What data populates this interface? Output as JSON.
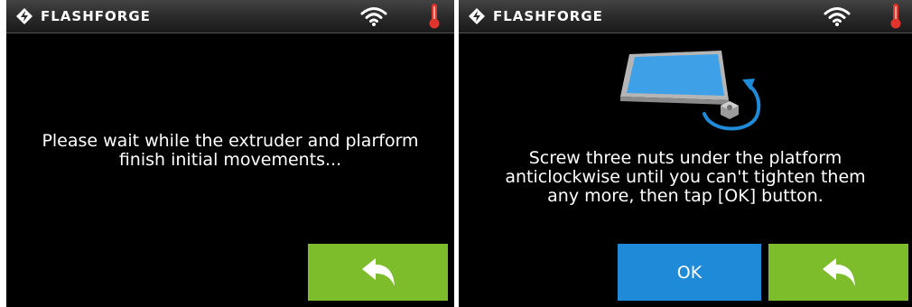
{
  "brand": {
    "name": "FLASHFORGE"
  },
  "icons": {
    "logo": "flashforge-logo-icon",
    "wifi": "wifi-icon",
    "temperature": "thermometer-icon",
    "back": "back-arrow-icon",
    "platform": "platform-nut-illustration"
  },
  "colors": {
    "topbar": "#2b2b2b",
    "screen_bg": "#000000",
    "back_button": "#7dbd2c",
    "ok_button": "#1f8ad7",
    "thermometer": "#e0342c",
    "platform": "#3ea1e8"
  },
  "left_screen": {
    "message": "Please wait while the extruder and plarform\nfinish initial movements..."
  },
  "right_screen": {
    "message": "Screw three nuts under the platform\nanticlockwise until you can't tighten them\nany more, then tap [OK] button.",
    "ok_label": "OK"
  }
}
